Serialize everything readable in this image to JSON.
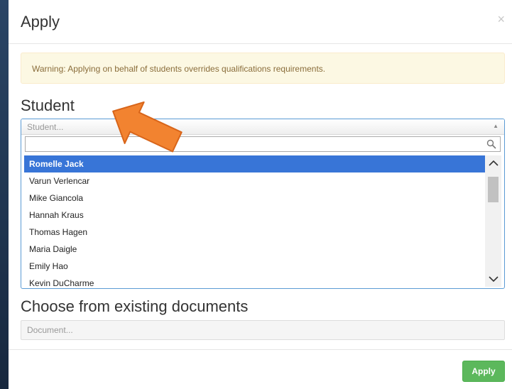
{
  "modal": {
    "title": "Apply",
    "close_symbol": "×"
  },
  "alert": {
    "text": "Warning: Applying on behalf of students overrides qualifications requirements."
  },
  "student": {
    "label": "Student",
    "placeholder": "Student...",
    "search_value": "",
    "results": [
      "Romelle Jack",
      "Varun Verlencar",
      "Mike Giancola",
      "Hannah Kraus",
      "Thomas Hagen",
      "Maria Daigle",
      "Emily Hao",
      "Kevin DuCharme"
    ],
    "highlighted_index": 0
  },
  "documents": {
    "label": "Choose from existing documents",
    "placeholder": "Document..."
  },
  "footer": {
    "apply_label": "Apply"
  },
  "colors": {
    "highlight": "#3875d7",
    "apply_button": "#5cb85c",
    "alert_bg": "#fcf8e3",
    "alert_text": "#8a6d3b",
    "annotation_arrow": "#f28330"
  },
  "icons": {
    "search": "search-icon",
    "close": "close-icon",
    "dropdown": "caret-up-icon",
    "scroll_up": "chevron-up-icon",
    "scroll_down": "chevron-down-icon"
  }
}
